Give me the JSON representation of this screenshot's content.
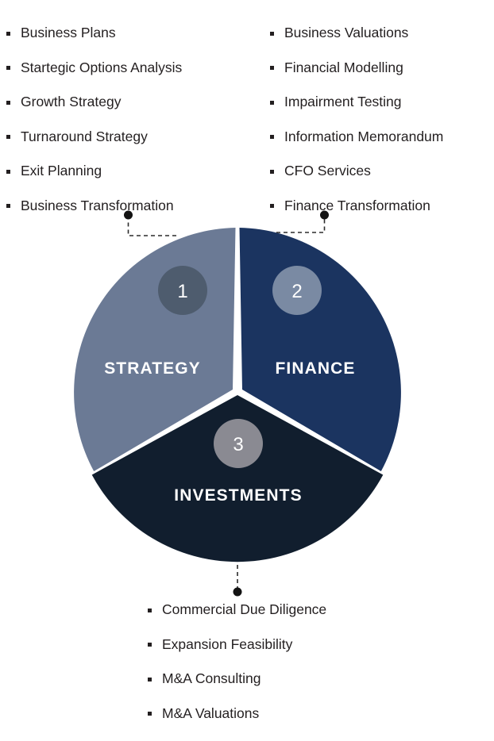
{
  "diagram": {
    "title": "Services wheel",
    "colors": {
      "strategy": "#6B7A95",
      "finance": "#1B3460",
      "investments": "#111E2E",
      "badge_1": "#4E5C6E",
      "badge_2": "#7A8AA3",
      "badge_3": "#8A8A92",
      "label_text": "#FFFFFF",
      "connector": "#2B2B2B",
      "background": "#FFFFFF"
    },
    "segments": [
      {
        "number": "1",
        "label": "STRATEGY"
      },
      {
        "number": "2",
        "label": "FINANCE"
      },
      {
        "number": "3",
        "label": "INVESTMENTS"
      }
    ]
  },
  "chart_data": {
    "type": "pie",
    "title": "",
    "categories": [
      "STRATEGY",
      "FINANCE",
      "INVESTMENTS"
    ],
    "values": [
      33.33,
      33.33,
      33.33
    ],
    "colors": [
      "#6B7A95",
      "#1B3460",
      "#111E2E"
    ],
    "legend": "none",
    "notes": "Three equal 120-degree slices separated by white gaps; numbered badges 1, 2, 3 sit inside each slice; dashed leader lines connect each slice to its service list."
  },
  "lists": {
    "strategy": {
      "items": [
        "Business Plans",
        "Startegic Options Analysis",
        "Growth Strategy",
        "Turnaround Strategy",
        "Exit Planning",
        "Business Transformation"
      ]
    },
    "finance": {
      "items": [
        "Business Valuations",
        "Financial Modelling",
        "Impairment Testing",
        "Information Memorandum",
        "CFO Services",
        "Finance Transformation"
      ]
    },
    "investments": {
      "items": [
        "Commercial Due Diligence",
        "Expansion Feasibility",
        "M&A Consulting",
        "M&A Valuations"
      ]
    }
  }
}
